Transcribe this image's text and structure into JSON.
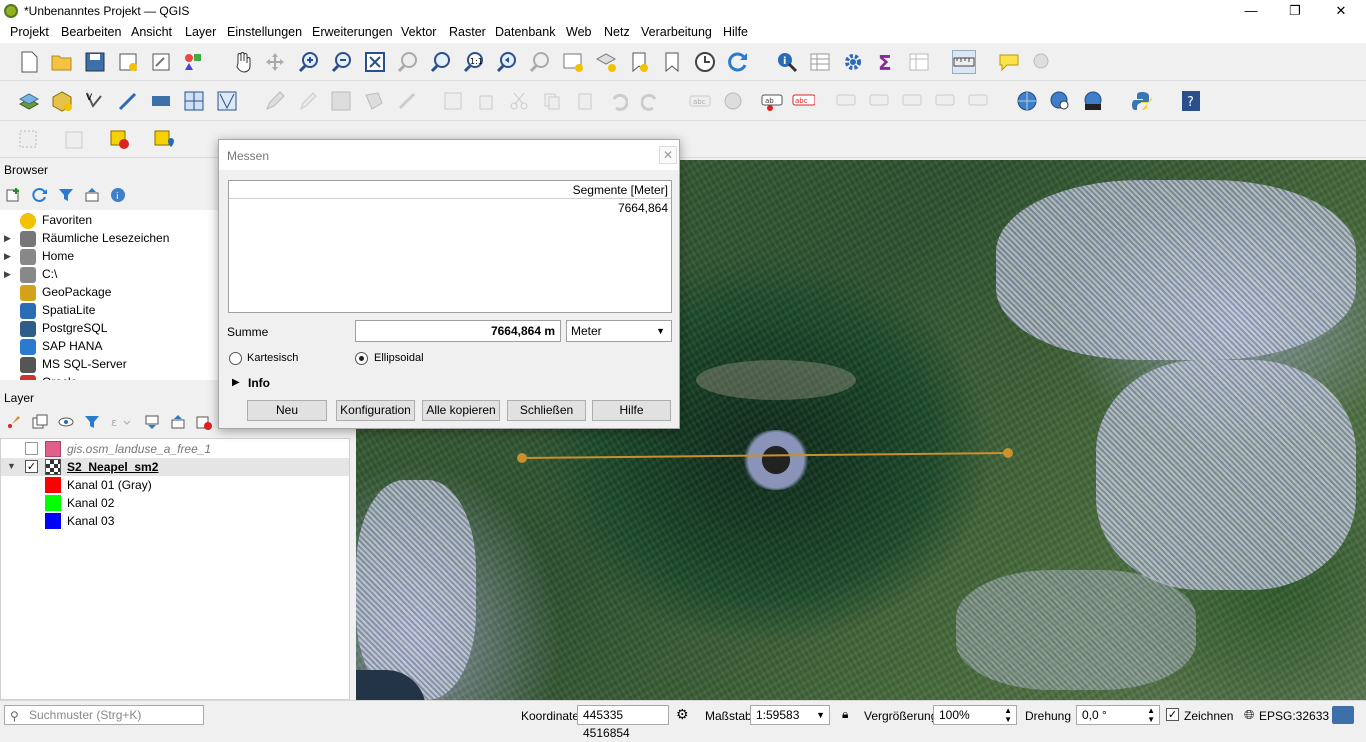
{
  "window": {
    "title": "*Unbenanntes Projekt — QGIS",
    "minimize": "—",
    "maximize": "❐",
    "close": "✕"
  },
  "menu": [
    "Projekt",
    "Bearbeiten",
    "Ansicht",
    "Layer",
    "Einstellungen",
    "Erweiterungen",
    "Vektor",
    "Raster",
    "Datenbank",
    "Web",
    "Netz",
    "Verarbeitung",
    "Hilfe"
  ],
  "browser": {
    "title": "Browser",
    "items": [
      {
        "label": "Favoriten",
        "icon": "star-icon",
        "arrow": ""
      },
      {
        "label": "Räumliche Lesezeichen",
        "icon": "bookmark-icon",
        "arrow": "▶"
      },
      {
        "label": "Home",
        "icon": "home-folder-icon",
        "arrow": "▶"
      },
      {
        "label": "C:\\",
        "icon": "drive-icon",
        "arrow": "▶"
      },
      {
        "label": "GeoPackage",
        "icon": "geopackage-icon",
        "arrow": ""
      },
      {
        "label": "SpatiaLite",
        "icon": "spatialite-icon",
        "arrow": ""
      },
      {
        "label": "PostgreSQL",
        "icon": "postgresql-icon",
        "arrow": ""
      },
      {
        "label": "SAP HANA",
        "icon": "sap-hana-icon",
        "arrow": ""
      },
      {
        "label": "MS SQL-Server",
        "icon": "mssql-icon",
        "arrow": ""
      },
      {
        "label": "Oracle",
        "icon": "oracle-icon",
        "arrow": ""
      }
    ]
  },
  "layers": {
    "title": "Layer",
    "items": [
      {
        "label": "gis.osm_landuse_a_free_1",
        "checked": false,
        "swatch": "#e0608a",
        "style": "italic-grey"
      },
      {
        "label": "S2_Neapel_sm2",
        "checked": true,
        "swatch": "",
        "style": "bold-underline"
      }
    ],
    "bands": [
      {
        "label": "Kanal 01 (Gray)",
        "color": "#ff0000"
      },
      {
        "label": "Kanal 02",
        "color": "#00ff00"
      },
      {
        "label": "Kanal 03",
        "color": "#0000ff"
      }
    ]
  },
  "measure": {
    "title": "Messen",
    "close": "✕",
    "column_header": "Segmente [Meter]",
    "segments": [
      "7664,864"
    ],
    "sum_label": "Summe",
    "sum_value": "7664,864 m",
    "unit": "Meter",
    "radio_cartesian": "Kartesisch",
    "radio_ellipsoidal": "Ellipsoidal",
    "radio_selected": "Ellipsoidal",
    "info_label": "Info",
    "buttons": {
      "new": "Neu",
      "config": "Konfiguration",
      "copy_all": "Alle kopieren",
      "close": "Schließen",
      "help": "Hilfe"
    }
  },
  "status": {
    "search_placeholder": "Suchmuster (Strg+K)",
    "coord_label": "Koordinate",
    "coord_value": "445335 4516854",
    "scale_label": "Maßstab",
    "scale_value": "1:59583",
    "magnifier_label": "Vergrößerung",
    "magnifier_value": "100%",
    "rotation_label": "Drehung",
    "rotation_value": "0,0 °",
    "render_label": "Zeichnen",
    "crs": "EPSG:32633"
  },
  "colors": {
    "measure_line": "#c8902e",
    "titlebar_bg": "#ffffff",
    "panel_bg": "#f0f0f0"
  }
}
